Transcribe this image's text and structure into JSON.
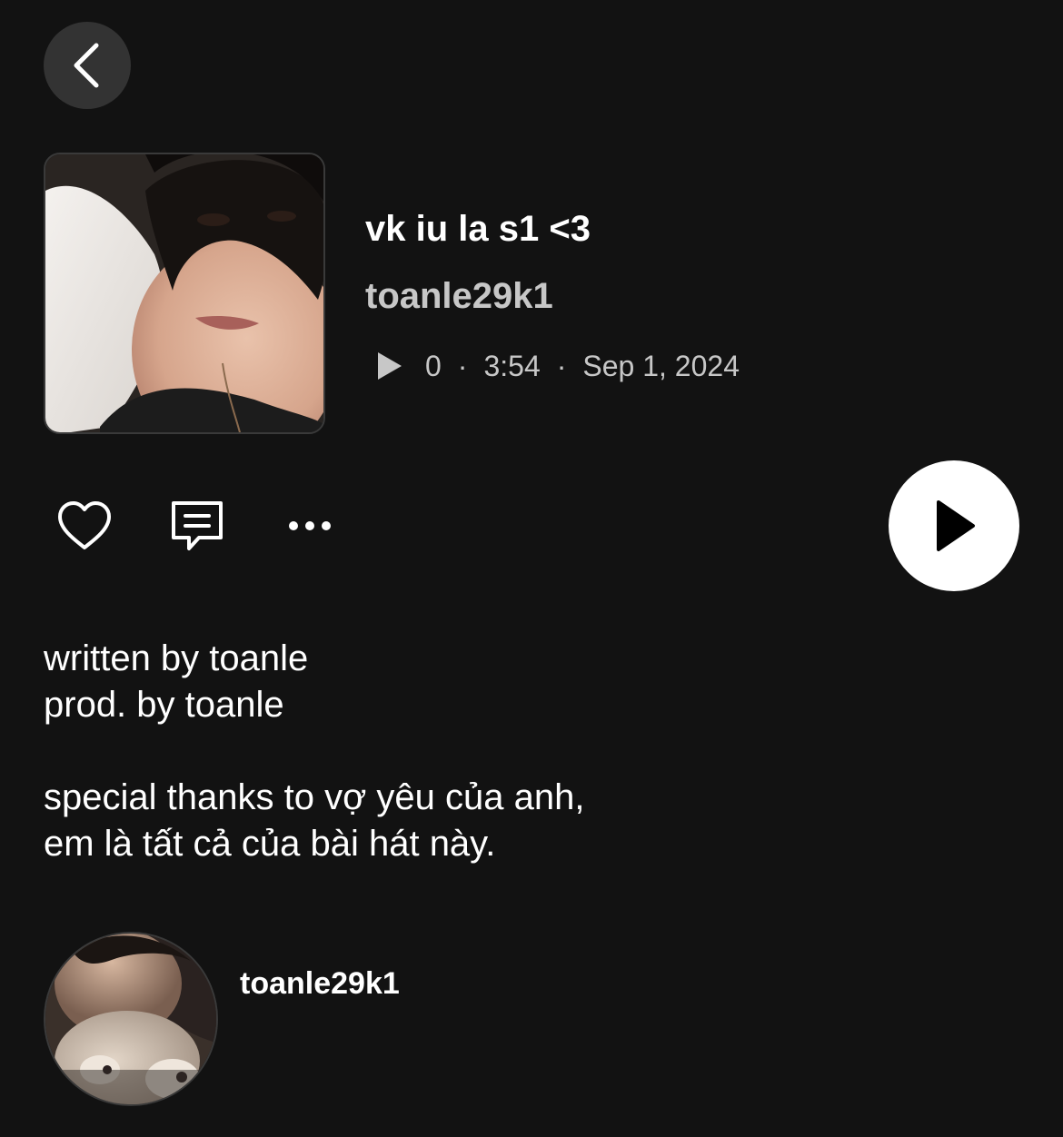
{
  "header": {
    "back_icon": "chevron-left-icon"
  },
  "track": {
    "cover_icon": "cover-art-photo",
    "title": "vk iu la s1 <3",
    "artist": "toanle29k1",
    "plays": "0",
    "duration": "3:54",
    "date": "Sep 1, 2024",
    "separator": "·"
  },
  "actions": {
    "like_icon": "heart-icon",
    "comment_icon": "comment-icon",
    "more_icon": "more-icon",
    "play_icon": "play-icon"
  },
  "description": {
    "lines": [
      "written by toanle",
      "prod. by toanle",
      "",
      "special thanks to vợ yêu của anh,",
      "em là tất cả của bài hát này."
    ]
  },
  "uploader": {
    "name": "toanle29k1",
    "avatar_icon": "avatar-photo"
  },
  "colors": {
    "background": "#121212",
    "surface": "#333333",
    "primary_text": "#ffffff",
    "secondary_text": "#c7c7c7"
  }
}
